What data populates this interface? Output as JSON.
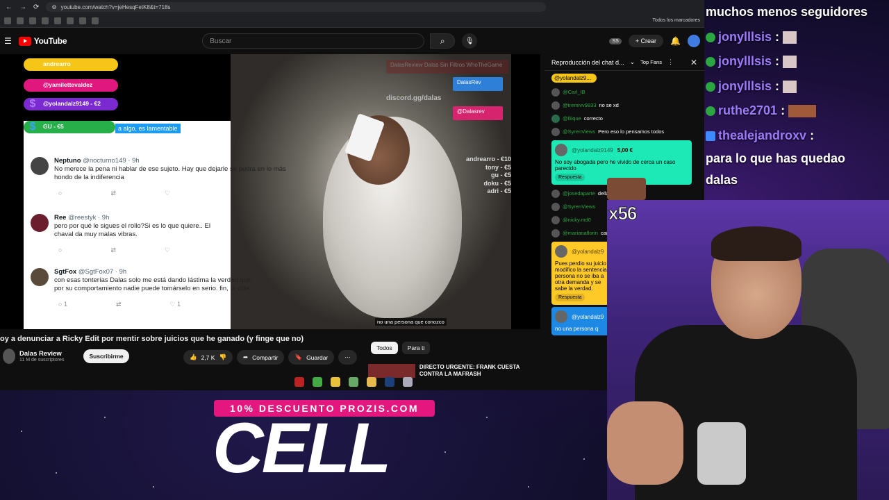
{
  "browser": {
    "url": "youtube.com/watch?v=jeHesqFetK8&t=718s",
    "bookmarks_label": "Todos los marcadores"
  },
  "youtube": {
    "logo": "YouTube",
    "search_placeholder": "Buscar",
    "ss_badge": "SS",
    "create_label": "Crear"
  },
  "video_overlay": {
    "badges": [
      {
        "label": "andrearro",
        "color": "#f5c518",
        "icon": "crown-icon"
      },
      {
        "label": "@yamilettevaldez",
        "color": "#e0187d",
        "icon": "heart-icon"
      },
      {
        "label": "@yolandalz9149 - €2",
        "color": "#7a2ad0",
        "icon": "dollar-icon"
      },
      {
        "label": "GU - €5",
        "color": "#27b04a",
        "icon": "money-icon"
      }
    ],
    "highlight_text": "a algo, es lamentable",
    "discord": "discord.gg/dalas",
    "social_top": "DalasReview Dalas Sin Filtros WhoTheGame",
    "social_twitter": "DalasRev",
    "social_instagram": "@Dalasrev",
    "donors": [
      "andrearro - €10",
      "tony - €5",
      "gu - €5",
      "doku - €5",
      "adri - €5"
    ],
    "subtitle": "no una persona que conozco"
  },
  "tweets": [
    {
      "name": "Neptuno",
      "handle": "@nocturno149 · 9h",
      "text": "No merece la pena ni hablar de ese sujeto. Hay que dejarle se pudra en lo más hondo de la indiferencia"
    },
    {
      "name": "Ree",
      "handle": "@reestyk · 9h",
      "text": "pero por qué le sigues el rollo?Si es lo que quiere.. El chaval da muy malas vibras."
    },
    {
      "name": "SgtFox",
      "handle": "@SgtFox07 · 9h",
      "text": "con esas tonterías Dalas solo me está dando lástima la verdad que por su comportamiento nadie puede tomárselo en serio. fin, la vida",
      "replies": "1",
      "likes": "1"
    }
  ],
  "video_info": {
    "title": "oy a denunciar a Ricky Edit por mentir sobre juicios que he ganado (y finge que no)",
    "channel": "Dalas Review",
    "subscribers": "11 M de suscriptores",
    "subscribe_label": "Suscribirme",
    "likes": "2,7 K",
    "share_label": "Compartir",
    "save_label": "Guardar"
  },
  "filters": [
    "Todos",
    "Para ti"
  ],
  "recommendation": {
    "title": "DIRECTO URGENTE: FRANK CUESTA CONTRA LA MAFRASH"
  },
  "chat": {
    "title": "Reproducción del chat d...",
    "top_fans": "Top Fans",
    "pinned": "@yolandalz9...",
    "messages": [
      {
        "user": "@Carl_IB",
        "text": ""
      },
      {
        "user": "@tremivv9833",
        "text": "no se xd"
      },
      {
        "user": "@lliique",
        "text": "correcto"
      },
      {
        "user": "@SyrenViews",
        "text": "Pero eso lo pensamos todos"
      }
    ],
    "superchat1": {
      "user": "@yolandalz9149",
      "amount": "5,00 €",
      "text": "No soy abogada pero he vivido de cerca un caso parecido",
      "reply": "Respuesta"
    },
    "messages2": [
      {
        "user": "@josedaparte",
        "text": "della"
      },
      {
        "user": "@SyrenViews",
        "text": ""
      },
      {
        "user": "@nicky.md0",
        "text": ""
      },
      {
        "user": "@marianaflorin",
        "text": "camino jajsjsj"
      }
    ],
    "superchat2": {
      "user": "@yolandalz9",
      "text": "Pues perdio su juicio y modifico la sentencia persona no se iba a otra demanda y se sabe la verdad.",
      "reply": "Respuesta"
    },
    "superchat3": {
      "user": "@yolandalz9",
      "text": "no una persona q"
    }
  },
  "stream_chat": {
    "top_line": "muchos menos seguidores",
    "lines": [
      {
        "user": "jonylllsis",
        "text": ":"
      },
      {
        "user": "jonylllsis",
        "text": ":"
      },
      {
        "user": "jonylllsis",
        "text": ":"
      },
      {
        "user": "ruthe2701",
        "text": ":"
      },
      {
        "user": "thealejandroxv",
        "text": ":"
      }
    ],
    "message_end": "para lo que has quedao dalas"
  },
  "stream_emote_count": "x56",
  "sponsor": {
    "promo": "10% DESCUENTO PROZIS.COM",
    "brand": "CELL"
  }
}
